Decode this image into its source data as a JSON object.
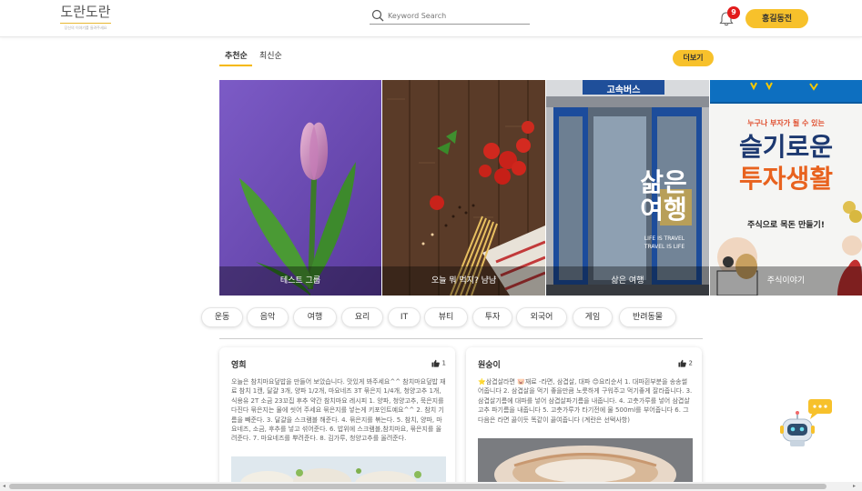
{
  "header": {
    "logo_text": "도란도란",
    "logo_subtitle": "당신의 이야기를 들려주세요",
    "search_placeholder": "Keyword Search",
    "notification_count": "9",
    "user_name": "홍길동전"
  },
  "sort_tabs": [
    {
      "label": "추천순",
      "active": true
    },
    {
      "label": "최신순",
      "active": false
    }
  ],
  "more_label": "더보기",
  "banners": [
    {
      "caption": "테스트 그룹"
    },
    {
      "caption": "오늘 뭐 먹지? 냠냠"
    },
    {
      "caption": "삶은 여행",
      "overlay_title": "삶은\n여행",
      "overlay_sub": "LIFE IS TRAVEL\nTRAVEL IS LIFE",
      "sign": "고속버스"
    },
    {
      "caption": "주식이야기",
      "top_text": "누구나 부자가 될 수 있는",
      "headline1": "슬기로운",
      "headline2": "투자생활",
      "sub": "주식으로 목돈 만들기!"
    }
  ],
  "categories": [
    "운동",
    "음악",
    "여행",
    "요리",
    "IT",
    "뷰티",
    "투자",
    "외국어",
    "게임",
    "반려동물"
  ],
  "posts": [
    {
      "author": "영희",
      "likes": "1",
      "text": "오늘은 참치마요덮밥을 만들어 보았습니다. 맛있게 봐주세요^^ 참치마요덮밥 재료 참치 1캔, 달걀 3개, 양파 1/2개, 마요네즈 3T 묶은지 1/4개, 청양고추 1개, 식용유 2T 소금 23꼬집 후추 약간 참치마요 레시피 1. 양파, 청양고추, 묵은지를 다진다 묶은지는 물에 씻어 주세요 묶은지를 넣는게 키포인트예요^^ 2. 참치 기름을 빼준다. 3. 달걀을 스크램블 해준다. 4. 묶은지를 볶는다. 5. 참치, 양파, 마요네즈, 소금, 후추를 넣고 섞어준다. 6. 밥위에 스크램블,참치마요, 묶은지를 올려준다. 7. 마요네즈를 뿌려준다. 8. 김가루, 청양고추를 올려준다."
    },
    {
      "author": "원숭이",
      "likes": "2",
      "text": "⭐삼겹살라면 🐷재료 -라면, 삼겹살, 대파 😊요리순서 1. 대파흰부분을 송송썰어줍니다 2. 삼겹살을 먹기 좋을만큼 노릇하게 구워주고 먹기좋게 잘라줍니다. 3. 삼겹살기름에 대파를 넣어 삼겹살파기름을 내줍니다. 4. 고춧가루를 넣어 삼겹살 고추 파기름을 내줍니다 5. 고춧가루가 타기전에 물 500ml를 부어줍니다 6. 그다음은 라면 끓이듯 똑같이 끓여줍니다 (계란은 선택사항)"
    }
  ],
  "colors": {
    "accent": "#f7c12b",
    "badge": "#e21b1b"
  }
}
